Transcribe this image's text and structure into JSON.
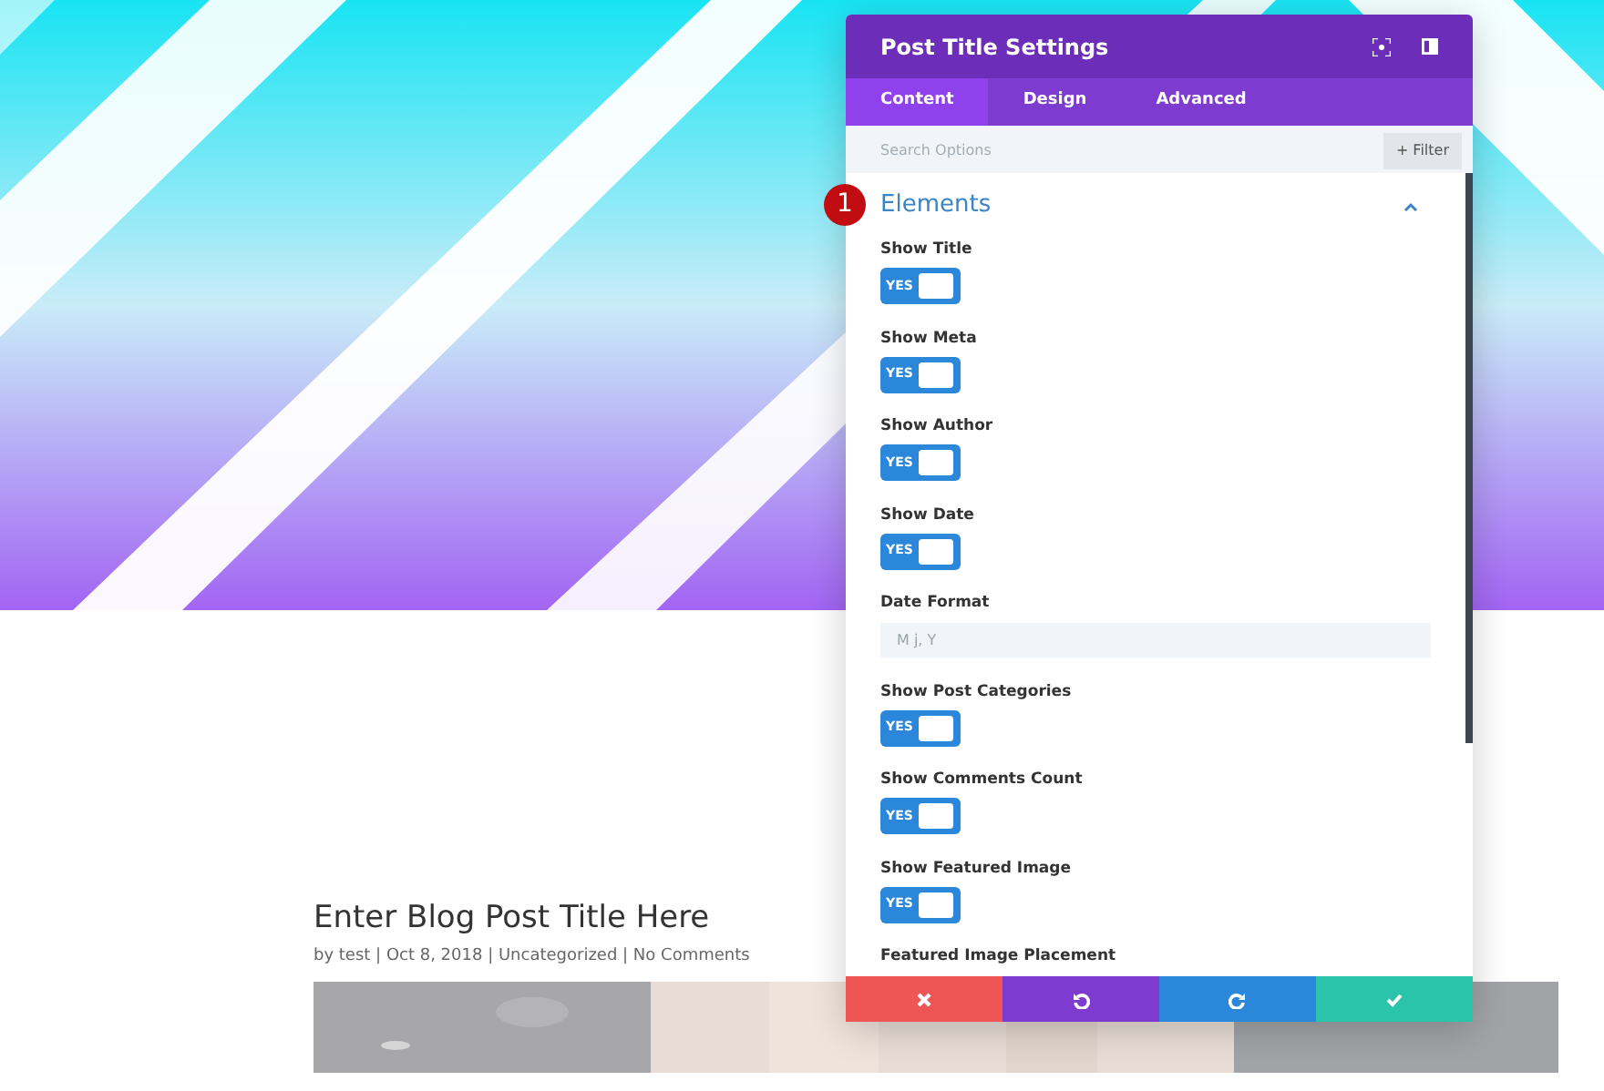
{
  "post": {
    "title": "Enter Blog Post Title Here",
    "meta": "by test | Oct 8, 2018 | Uncategorized | No Comments"
  },
  "modal": {
    "title": "Post Title Settings",
    "tabs": [
      {
        "label": "Content",
        "selected": true
      },
      {
        "label": "Design",
        "selected": false
      },
      {
        "label": "Advanced",
        "selected": false
      }
    ],
    "search": {
      "placeholder": "Search Options"
    },
    "filter_button": {
      "label": "+ Filter"
    },
    "step_badge": "1",
    "section": {
      "title": "Elements",
      "expanded": true
    },
    "options": [
      {
        "kind": "toggle",
        "label": "Show Title",
        "on": true,
        "value": "YES"
      },
      {
        "kind": "toggle",
        "label": "Show Meta",
        "on": true,
        "value": "YES"
      },
      {
        "kind": "toggle",
        "label": "Show Author",
        "on": true,
        "value": "YES"
      },
      {
        "kind": "toggle",
        "label": "Show Date",
        "on": true,
        "value": "YES"
      },
      {
        "kind": "text",
        "label": "Date Format",
        "placeholder": "M j, Y"
      },
      {
        "kind": "toggle",
        "label": "Show Post Categories",
        "on": true,
        "value": "YES"
      },
      {
        "kind": "toggle",
        "label": "Show Comments Count",
        "on": true,
        "value": "YES"
      },
      {
        "kind": "toggle",
        "label": "Show Featured Image",
        "on": true,
        "value": "YES"
      },
      {
        "kind": "label",
        "label": "Featured Image Placement"
      }
    ],
    "footer": [
      {
        "kind": "cancel"
      },
      {
        "kind": "undo"
      },
      {
        "kind": "redo"
      },
      {
        "kind": "save"
      }
    ]
  }
}
